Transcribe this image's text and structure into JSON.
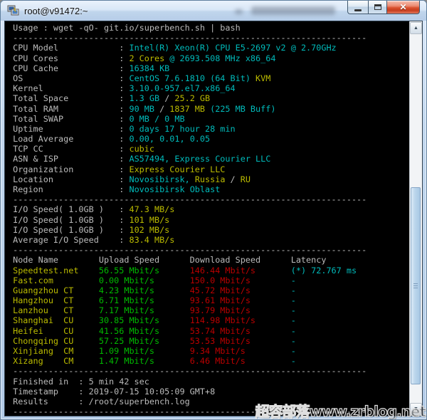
{
  "window": {
    "title": "root@v91472:~",
    "controls": {
      "close_glyph": "✕"
    },
    "chrome_colors": {
      "titlebar": "#c3d8ef",
      "close_button_red": "#d9512f"
    }
  },
  "scrollbar": {
    "up_glyph": "▲",
    "down_glyph": "▼"
  },
  "watermark": {
    "text": "超容部落www.zrblog.net"
  },
  "terminal": {
    "palette": {
      "background": "#000000",
      "white": "#bbbbbb",
      "cyan": "#00bbbb",
      "yellow": "#bbbb00",
      "green": "#00bb00",
      "red": "#bb0000"
    },
    "lines": [
      [
        [
          "w",
          " Usage : wget -qO- git.io/superbench.sh | bash"
        ]
      ],
      [
        [
          "w",
          " ----------------------------------------------------------------------"
        ]
      ],
      [
        [
          "w",
          " CPU Model            : "
        ],
        [
          "c",
          "Intel(R) Xeon(R) CPU E5-2697 v2 @ 2.70GHz"
        ]
      ],
      [
        [
          "w",
          " CPU Cores            : "
        ],
        [
          "y",
          "2 Cores"
        ],
        [
          "c",
          " @ 2693.508 MHz x86_64"
        ]
      ],
      [
        [
          "w",
          " CPU Cache            : "
        ],
        [
          "c",
          "16384 KB"
        ]
      ],
      [
        [
          "w",
          " OS                   : "
        ],
        [
          "c",
          "CentOS 7.6.1810 (64 Bit) "
        ],
        [
          "y",
          "KVM"
        ]
      ],
      [
        [
          "w",
          " Kernel               : "
        ],
        [
          "c",
          "3.10.0-957.el7.x86_64"
        ]
      ],
      [
        [
          "w",
          " Total Space          : "
        ],
        [
          "c",
          "1.3 GB"
        ],
        [
          "w",
          " / "
        ],
        [
          "y",
          "25.2 GB"
        ]
      ],
      [
        [
          "w",
          " Total RAM            : "
        ],
        [
          "c",
          "90 MB"
        ],
        [
          "w",
          " / "
        ],
        [
          "y",
          "1837 MB"
        ],
        [
          "c",
          " (225 MB Buff)"
        ]
      ],
      [
        [
          "w",
          " Total SWAP           : "
        ],
        [
          "c",
          "0 MB / 0 MB"
        ]
      ],
      [
        [
          "w",
          " Uptime               : "
        ],
        [
          "c",
          "0 days 17 hour 28 min"
        ]
      ],
      [
        [
          "w",
          " Load Average         : "
        ],
        [
          "c",
          "0.00, 0.01, 0.05"
        ]
      ],
      [
        [
          "w",
          " TCP CC               : "
        ],
        [
          "y",
          "cubic"
        ]
      ],
      [
        [
          "w",
          " ASN & ISP            : "
        ],
        [
          "c",
          "AS57494, Express Courier LLC"
        ]
      ],
      [
        [
          "w",
          " Organization         : "
        ],
        [
          "y",
          "Express Courier LLC"
        ]
      ],
      [
        [
          "w",
          " Location             : "
        ],
        [
          "c",
          "Novosibirsk, "
        ],
        [
          "y",
          "Russia"
        ],
        [
          "w",
          " / "
        ],
        [
          "y",
          "RU"
        ]
      ],
      [
        [
          "w",
          " Region               : "
        ],
        [
          "c",
          "Novosibirsk Oblast"
        ]
      ],
      [
        [
          "w",
          " ----------------------------------------------------------------------"
        ]
      ],
      [
        [
          "w",
          " I/O Speed( 1.0GB )   : "
        ],
        [
          "y",
          "47.3 MB/s"
        ]
      ],
      [
        [
          "w",
          " I/O Speed( 1.0GB )   : "
        ],
        [
          "y",
          "101 MB/s"
        ]
      ],
      [
        [
          "w",
          " I/O Speed( 1.0GB )   : "
        ],
        [
          "y",
          "102 MB/s"
        ]
      ],
      [
        [
          "w",
          " Average I/O Speed    : "
        ],
        [
          "y",
          "83.4 MB/s"
        ]
      ],
      [
        [
          "w",
          " ----------------------------------------------------------------------"
        ]
      ],
      [
        [
          "w",
          " Node Name        Upload Speed      Download Speed      Latency"
        ]
      ],
      [
        [
          "y",
          " Speedtest.net    "
        ],
        [
          "g",
          "56.55 Mbit/s      "
        ],
        [
          "r",
          "146.44 Mbit/s       "
        ],
        [
          "c",
          "(*) 72.767 ms"
        ]
      ],
      [
        [
          "y",
          " Fast.com         "
        ],
        [
          "g",
          "0.00 Mbit/s       "
        ],
        [
          "r",
          "150.0 Mbit/s        "
        ],
        [
          "c",
          "-"
        ]
      ],
      [
        [
          "y",
          " Guangzhou CT     "
        ],
        [
          "g",
          "4.23 Mbit/s       "
        ],
        [
          "r",
          "45.72 Mbit/s        "
        ],
        [
          "c",
          "-"
        ]
      ],
      [
        [
          "y",
          " Hangzhou  CT     "
        ],
        [
          "g",
          "6.71 Mbit/s       "
        ],
        [
          "r",
          "93.61 Mbit/s        "
        ],
        [
          "c",
          "-"
        ]
      ],
      [
        [
          "y",
          " Lanzhou   CT     "
        ],
        [
          "g",
          "7.17 Mbit/s       "
        ],
        [
          "r",
          "93.79 Mbit/s        "
        ],
        [
          "c",
          "-"
        ]
      ],
      [
        [
          "y",
          " Shanghai  CU     "
        ],
        [
          "g",
          "30.85 Mbit/s      "
        ],
        [
          "r",
          "114.98 Mbit/s       "
        ],
        [
          "c",
          "-"
        ]
      ],
      [
        [
          "y",
          " Heifei    CU     "
        ],
        [
          "g",
          "41.56 Mbit/s      "
        ],
        [
          "r",
          "53.74 Mbit/s        "
        ],
        [
          "c",
          "-"
        ]
      ],
      [
        [
          "y",
          " Chongqing CU     "
        ],
        [
          "g",
          "57.25 Mbit/s      "
        ],
        [
          "r",
          "53.53 Mbit/s        "
        ],
        [
          "c",
          "-"
        ]
      ],
      [
        [
          "y",
          " Xinjiang  CM     "
        ],
        [
          "g",
          "1.09 Mbit/s       "
        ],
        [
          "r",
          "9.34 Mbit/s         "
        ],
        [
          "c",
          "-"
        ]
      ],
      [
        [
          "y",
          " Xizang    CM     "
        ],
        [
          "g",
          "1.47 Mbit/s       "
        ],
        [
          "r",
          "6.46 Mbit/s         "
        ],
        [
          "c",
          "-"
        ]
      ],
      [
        [
          "w",
          " ----------------------------------------------------------------------"
        ]
      ],
      [
        [
          "w",
          " Finished in  : 5 min 42 sec"
        ]
      ],
      [
        [
          "w",
          " Timestamp    : 2019-07-15 10:05:09 GMT+8"
        ]
      ],
      [
        [
          "w",
          " Results      : /root/superbench.log"
        ]
      ],
      [
        [
          "w",
          " ----------------------------------------------------------------------"
        ]
      ]
    ]
  }
}
